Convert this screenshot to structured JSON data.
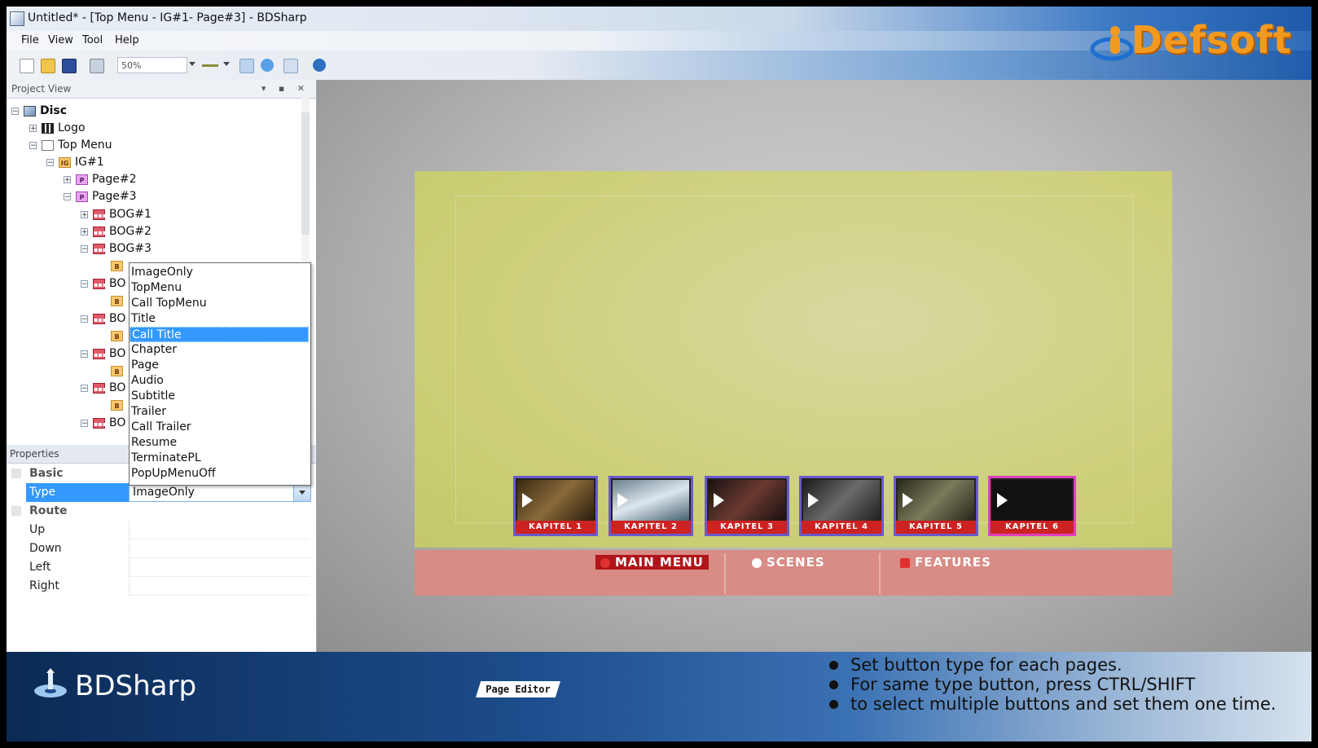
{
  "window": {
    "title": "Untitled* - [Top Menu - IG#1- Page#3] - BDSharp"
  },
  "menu": [
    "File",
    "View",
    "Tool",
    "Help"
  ],
  "toolbar": {
    "zoom": "50%"
  },
  "logo": "Defsoft",
  "project_view": {
    "title": "Project View",
    "tree": [
      {
        "label": "Disc",
        "icon": "disc"
      },
      {
        "label": "Logo",
        "icon": "clapper"
      },
      {
        "label": "Top Menu",
        "icon": "menu"
      },
      {
        "label": "IG#1",
        "icon": "ig"
      },
      {
        "label": "Page#2",
        "icon": "page"
      },
      {
        "label": "Page#3",
        "icon": "page"
      },
      {
        "label": "BOG#1",
        "icon": "bog"
      },
      {
        "label": "BOG#2",
        "icon": "bog"
      },
      {
        "label": "BOG#3",
        "icon": "bog"
      },
      {
        "label": "",
        "icon": "button"
      },
      {
        "label": "BO",
        "icon": "bog"
      },
      {
        "label": "",
        "icon": "button"
      },
      {
        "label": "BO",
        "icon": "bog"
      },
      {
        "label": "",
        "icon": "button"
      },
      {
        "label": "BO",
        "icon": "bog"
      },
      {
        "label": "",
        "icon": "button"
      },
      {
        "label": "BO",
        "icon": "bog"
      },
      {
        "label": "",
        "icon": "button"
      },
      {
        "label": "BO",
        "icon": "bog"
      }
    ]
  },
  "properties": {
    "title": "Properties",
    "cat_basic": "Basic",
    "type_label": "Type",
    "type_value": "ImageOnly",
    "cat_route": "Route",
    "up": "Up",
    "down": "Down",
    "left": "Left",
    "right": "Right"
  },
  "type_options": [
    "ImageOnly",
    "TopMenu",
    "Call TopMenu",
    "Title",
    "Call Title",
    "Chapter",
    "Page",
    "Audio",
    "Subtitle",
    "Trailer",
    "Call Trailer",
    "Resume",
    "TerminatePL",
    "PopUpMenuOff"
  ],
  "type_selected_option": "Call Title",
  "editor": {
    "chapters": [
      "KAPITEL 1",
      "KAPITEL 2",
      "KAPITEL 3",
      "KAPITEL 4",
      "KAPITEL 5",
      "KAPITEL 6"
    ],
    "nav": [
      "MAIN MENU",
      "SCENES",
      "FEATURES"
    ]
  },
  "footer": {
    "brand": "BDSharp",
    "tag": "Page Editor",
    "tips": [
      "Set button type for each pages.",
      "For same type button, press CTRL/SHIFT",
      "to select multiple buttons and set them one time."
    ]
  },
  "colors": {
    "accent": "#3399ff",
    "logo": "#f39a1e",
    "canvas": "#cdd07a",
    "nav": "#d98b85"
  }
}
